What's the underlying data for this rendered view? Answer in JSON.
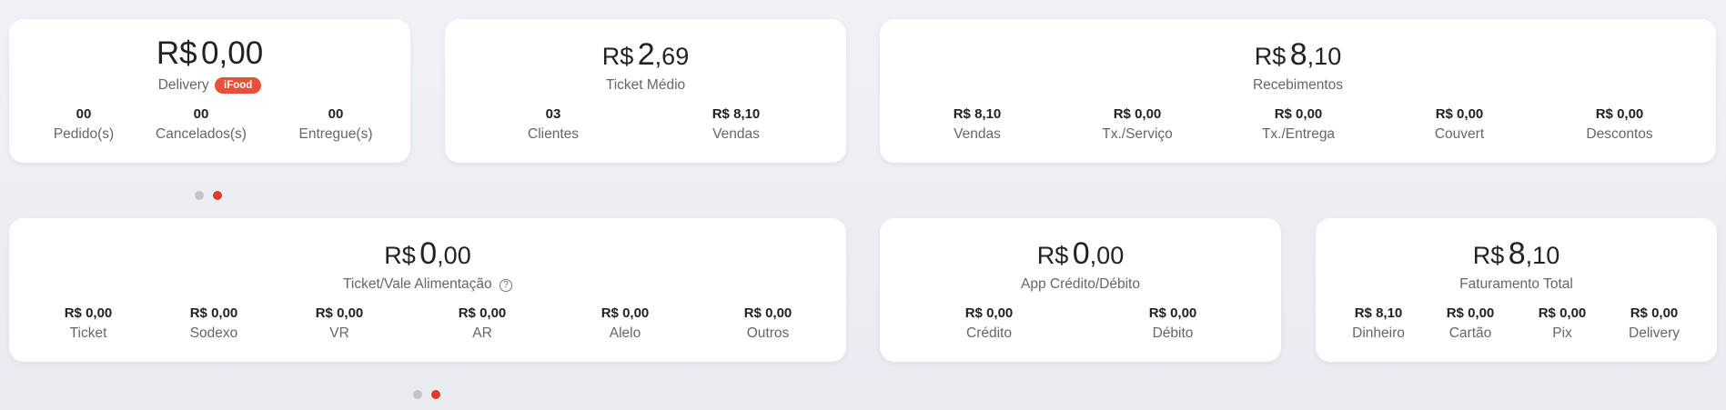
{
  "delivery": {
    "amount": {
      "currency": "R$",
      "int": "0",
      "dec": ",00"
    },
    "label": "Delivery",
    "badge": "iFood",
    "stats": [
      {
        "value": "00",
        "label": "Pedido(s)"
      },
      {
        "value": "00",
        "label": "Cancelados(s)"
      },
      {
        "value": "00",
        "label": "Entregue(s)"
      }
    ]
  },
  "ticket_medio": {
    "amount": {
      "currency": "R$",
      "int": "2",
      "dec": ",69"
    },
    "label": "Ticket Médio",
    "stats": [
      {
        "value": "03",
        "label": "Clientes"
      },
      {
        "value": "R$ 8,10",
        "label": "Vendas"
      }
    ]
  },
  "recebimentos": {
    "amount": {
      "currency": "R$",
      "int": "8",
      "dec": ",10"
    },
    "label": "Recebimentos",
    "stats": [
      {
        "value": "R$ 8,10",
        "label": "Vendas"
      },
      {
        "value": "R$ 0,00",
        "label": "Tx./Serviço"
      },
      {
        "value": "R$ 0,00",
        "label": "Tx./Entrega"
      },
      {
        "value": "R$ 0,00",
        "label": "Couvert"
      },
      {
        "value": "R$ 0,00",
        "label": "Descontos"
      }
    ]
  },
  "vale_alimentacao": {
    "amount": {
      "currency": "R$",
      "int": "0",
      "dec": ",00"
    },
    "label": "Ticket/Vale Alimentação",
    "help_icon": "?",
    "stats": [
      {
        "value": "R$ 0,00",
        "label": "Ticket"
      },
      {
        "value": "R$ 0,00",
        "label": "Sodexo"
      },
      {
        "value": "R$ 0,00",
        "label": "VR"
      },
      {
        "value": "R$ 0,00",
        "label": "AR"
      },
      {
        "value": "R$ 0,00",
        "label": "Alelo"
      },
      {
        "value": "R$ 0,00",
        "label": "Outros"
      }
    ]
  },
  "app_credito": {
    "amount": {
      "currency": "R$",
      "int": "0",
      "dec": ",00"
    },
    "label": "App Crédito/Débito",
    "stats": [
      {
        "value": "R$ 0,00",
        "label": "Crédito"
      },
      {
        "value": "R$ 0,00",
        "label": "Débito"
      }
    ]
  },
  "faturamento": {
    "amount": {
      "currency": "R$",
      "int": "8",
      "dec": ",10"
    },
    "label": "Faturamento Total",
    "stats": [
      {
        "value": "R$ 8,10",
        "label": "Dinheiro"
      },
      {
        "value": "R$ 0,00",
        "label": "Cartão"
      },
      {
        "value": "R$ 0,00",
        "label": "Pix"
      },
      {
        "value": "R$ 0,00",
        "label": "Delivery"
      }
    ]
  },
  "carousels": [
    {
      "pages": 2,
      "active": 2
    },
    {
      "pages": 2,
      "active": 2
    }
  ],
  "colors": {
    "accent": "#e03a2a",
    "badge": "#e8503a",
    "dot_inactive": "#c4c4c4"
  }
}
